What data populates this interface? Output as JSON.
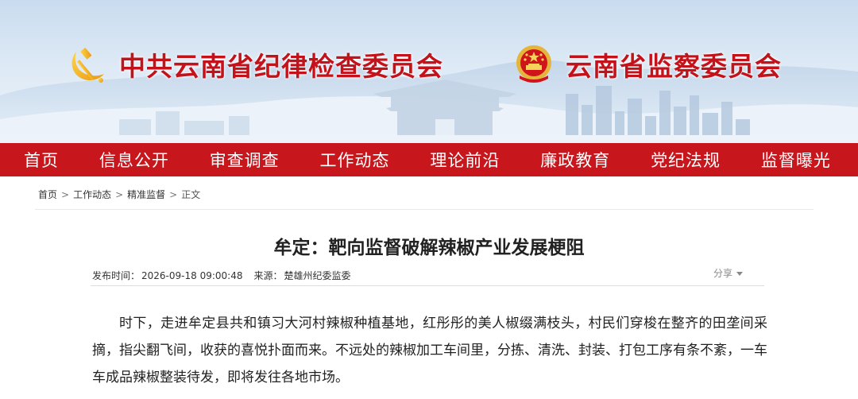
{
  "header": {
    "left_title": "中共云南省纪律检查委员会",
    "right_title": "云南省监察委员会",
    "left_emblem_icon": "party-emblem-icon",
    "right_emblem_icon": "national-emblem-icon",
    "colors": {
      "brand_red": "#c4121a",
      "nav_red": "#c8161d",
      "sky": "#dde9f5"
    }
  },
  "nav": {
    "items": [
      {
        "label": "首页"
      },
      {
        "label": "信息公开"
      },
      {
        "label": "审查调查"
      },
      {
        "label": "工作动态"
      },
      {
        "label": "理论前沿"
      },
      {
        "label": "廉政教育"
      },
      {
        "label": "党纪法规"
      },
      {
        "label": "监督曝光"
      }
    ]
  },
  "breadcrumb": {
    "items": [
      {
        "label": "首页"
      },
      {
        "label": "工作动态"
      },
      {
        "label": "精准监督"
      },
      {
        "label": "正文"
      }
    ],
    "separator": ">"
  },
  "article": {
    "title": "牟定：靶向监督破解辣椒产业发展梗阻",
    "publish_label": "发布时间：",
    "publish_time": "2026-09-18 09:00:48",
    "source_label": "来源：",
    "source": "楚雄州纪委监委",
    "share_label": "分享",
    "paragraphs": [
      "时下，走进牟定县共和镇习大河村辣椒种植基地，红彤彤的美人椒缀满枝头，村民们穿梭在整齐的田垄间采摘，指尖翻飞间，收获的喜悦扑面而来。不远处的辣椒加工车间里，分拣、清洗、封装、打包工序有条不紊，一车车成品辣椒整装待发，即将发往各地市场。"
    ]
  }
}
